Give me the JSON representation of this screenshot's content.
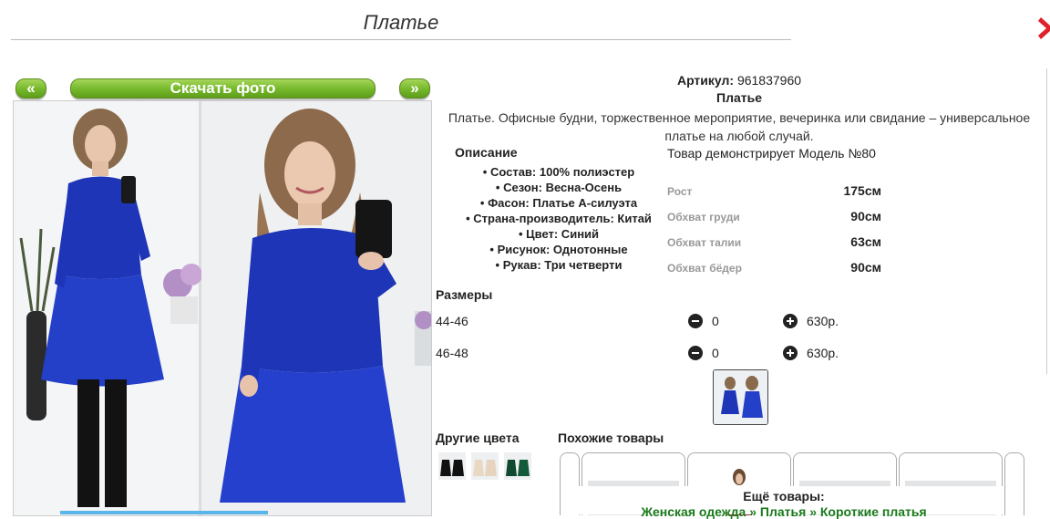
{
  "header": {
    "title": "Платье"
  },
  "nav": {
    "prev_label": "«",
    "download_label": "Скачать фото",
    "next_label": "»"
  },
  "product": {
    "article_label": "Артикул:",
    "article_value": "961837960",
    "name": "Платье",
    "description": "Платье. Офисные будни, торжественное мероприятие, вечеринка или свидание – универсальное платье на любой случай."
  },
  "specs": {
    "heading": "Описание",
    "items": [
      "Состав: 100% полиэстер",
      "Сезон: Весна-Осень",
      "Фасон: Платье А-силуэта",
      "Страна-производитель: Китай",
      "Цвет: Синий",
      "Рисунок: Однотонные",
      "Рукав: Три четверти"
    ]
  },
  "model": {
    "heading": "Товар демонстрирует Модель №80",
    "measurements": [
      {
        "label": "Рост",
        "value": "175см"
      },
      {
        "label": "Обхват груди",
        "value": "90см"
      },
      {
        "label": "Обхват талии",
        "value": "63см"
      },
      {
        "label": "Обхват бёдер",
        "value": "90см"
      }
    ]
  },
  "sizes": {
    "heading": "Размеры",
    "rows": [
      {
        "size": "44-46",
        "qty": "0",
        "price": "630р."
      },
      {
        "size": "46-48",
        "qty": "0",
        "price": "630р."
      }
    ]
  },
  "other_colors": {
    "heading": "Другие цвета"
  },
  "similar": {
    "heading": "Похожие товары"
  },
  "more": {
    "heading": "Ещё товары:",
    "crumbs": [
      "Женская одежда",
      "Платья",
      "Короткие платья"
    ],
    "separator": "»"
  },
  "colors": {
    "accent_green": "#74b72a",
    "dress_blue": "#1f35b8",
    "close_red": "#e0202a",
    "crumb_green": "#1a7a1a"
  },
  "icons": {
    "close": "close-icon",
    "minus": "minus-circle-icon",
    "plus": "plus-circle-icon"
  }
}
